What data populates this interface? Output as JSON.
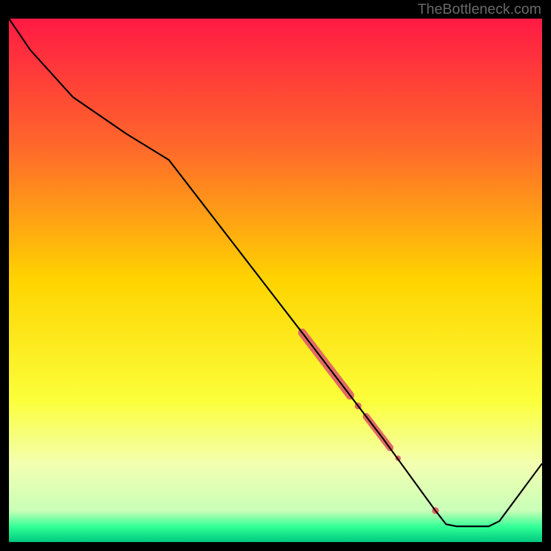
{
  "watermark": "TheBottleneck.com",
  "chart_data": {
    "type": "line",
    "title": "",
    "xlabel": "",
    "ylabel": "",
    "xlim": [
      0,
      100
    ],
    "ylim": [
      0,
      100
    ],
    "background_gradient": {
      "stops": [
        {
          "pos": 0.0,
          "color": "#ff1a44"
        },
        {
          "pos": 0.25,
          "color": "#ff6a2a"
        },
        {
          "pos": 0.5,
          "color": "#ffd400"
        },
        {
          "pos": 0.73,
          "color": "#fbff3a"
        },
        {
          "pos": 0.85,
          "color": "#f3ffb0"
        },
        {
          "pos": 0.94,
          "color": "#c9ffb8"
        },
        {
          "pos": 0.972,
          "color": "#2dff95"
        },
        {
          "pos": 1.0,
          "color": "#00c880"
        }
      ]
    },
    "series": [
      {
        "name": "bottleneck-curve",
        "color": "#000000",
        "points": [
          {
            "x": 0.0,
            "y": 100.0
          },
          {
            "x": 4.0,
            "y": 94.0
          },
          {
            "x": 12.0,
            "y": 85.0
          },
          {
            "x": 22.0,
            "y": 78.0
          },
          {
            "x": 30.0,
            "y": 73.0
          },
          {
            "x": 55.0,
            "y": 40.0
          },
          {
            "x": 70.0,
            "y": 20.0
          },
          {
            "x": 80.0,
            "y": 6.0
          },
          {
            "x": 82.0,
            "y": 3.4
          },
          {
            "x": 84.0,
            "y": 3.0
          },
          {
            "x": 90.0,
            "y": 3.0
          },
          {
            "x": 92.0,
            "y": 4.0
          },
          {
            "x": 100.0,
            "y": 15.0
          }
        ]
      }
    ],
    "markers": [
      {
        "name": "thick-segment",
        "kind": "thick-line",
        "color": "#e36a63",
        "width": 12,
        "from": {
          "x": 55.0,
          "y": 40.0
        },
        "to": {
          "x": 64.0,
          "y": 28.0
        }
      },
      {
        "name": "dot-a",
        "kind": "dot",
        "color": "#e36a63",
        "r": 5,
        "x": 65.5,
        "y": 26.0
      },
      {
        "name": "mid-segment",
        "kind": "thick-line",
        "color": "#e36a63",
        "width": 10,
        "from": {
          "x": 67.0,
          "y": 24.0
        },
        "to": {
          "x": 71.5,
          "y": 18.0
        }
      },
      {
        "name": "dot-b",
        "kind": "dot",
        "color": "#e36a63",
        "r": 4,
        "x": 73.0,
        "y": 16.0
      },
      {
        "name": "dot-c",
        "kind": "dot",
        "color": "#e36a63",
        "r": 5,
        "x": 80.0,
        "y": 6.0
      }
    ]
  }
}
